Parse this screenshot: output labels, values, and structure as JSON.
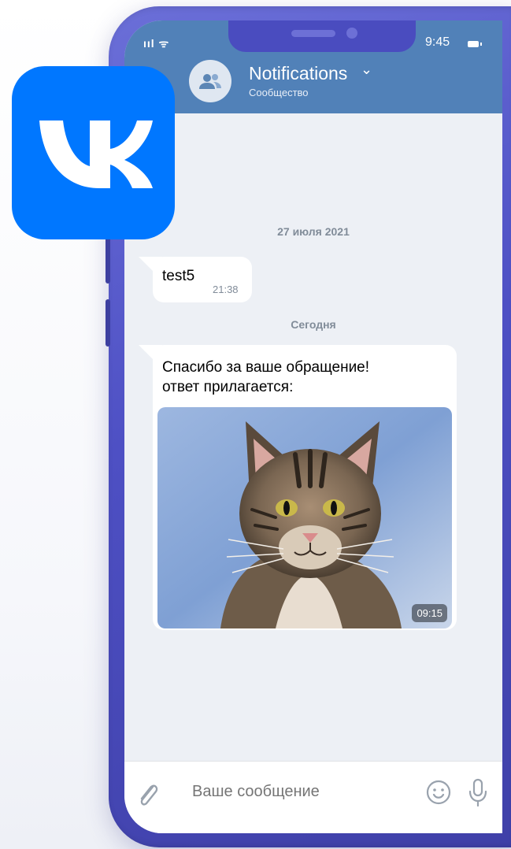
{
  "status_bar": {
    "signal": "ııl ᯤ",
    "time": "9:45"
  },
  "header": {
    "back_glyph": "‹",
    "title": "Notifications",
    "chevron": "⌄",
    "subtitle": "Сообщество"
  },
  "chat": {
    "dates": [
      "27 июля 2021",
      "Сегодня"
    ],
    "messages": [
      {
        "text": "test5",
        "time": "21:38"
      },
      {
        "text_line1": "Спасибо за ваше обращение!",
        "text_line2": "ответ прилагается:",
        "photo_time": "09:15"
      }
    ]
  },
  "composer": {
    "placeholder": "Ваше сообщение"
  },
  "icons": {
    "brand_logo": "vk-logo",
    "avatar": "users-icon",
    "attach": "paperclip-icon",
    "emoji": "smile-icon",
    "voice": "microphone-icon"
  },
  "colors": {
    "header_bg": "#5181b8",
    "chat_bg": "#edf0f5",
    "vk_blue": "#0077ff",
    "phone_frame": "#4e50c4"
  }
}
